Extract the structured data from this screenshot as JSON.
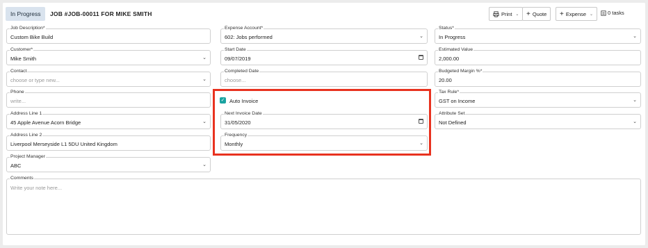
{
  "header": {
    "status_badge": "In Progress",
    "job_title": "JOB #JOB-00011 FOR MIKE SMITH",
    "print_label": "Print",
    "quote_label": "Quote",
    "expense_label": "Expense",
    "tasks_label": "0 tasks"
  },
  "fields": {
    "job_description": {
      "label": "Job Description*",
      "value": "Custom Bike Build"
    },
    "customer": {
      "label": "Customer*",
      "value": "Mike Smith"
    },
    "contact": {
      "label": "Contact",
      "placeholder": "choose or type new..."
    },
    "phone": {
      "label": "Phone",
      "placeholder": "write..."
    },
    "address1": {
      "label": "Address Line 1",
      "value": "45 Apple Avenue Acorn Bridge"
    },
    "address2": {
      "label": "Address Line 2",
      "value": "Liverpool Merseyside L1 5DU United Kingdom"
    },
    "project_manager": {
      "label": "Project Manager",
      "value": "ABC"
    },
    "expense_account": {
      "label": "Expense Account*",
      "value": "602: Jobs performed"
    },
    "start_date": {
      "label": "Start Date",
      "value": "09/07/2019"
    },
    "completed_date": {
      "label": "Completed Date",
      "placeholder": "choose..."
    },
    "auto_invoice": {
      "label": "Auto Invoice",
      "checked": true
    },
    "next_invoice_date": {
      "label": "Next Invoice Date",
      "value": "31/05/2020"
    },
    "frequency": {
      "label": "Frequency",
      "value": "Monthly"
    },
    "status": {
      "label": "Status*",
      "value": "In Progress"
    },
    "estimated_value": {
      "label": "Estimated Value",
      "value": "2,000.00"
    },
    "budgeted_margin": {
      "label": "Budgeted Margin %*",
      "value": "20.00"
    },
    "tax_rule": {
      "label": "Tax Rule*",
      "value": "GST on Income"
    },
    "attribute_set": {
      "label": "Attribute Set",
      "value": "Not Defined"
    },
    "comments": {
      "label": "Comments",
      "placeholder": "Write your note here..."
    }
  },
  "icons": {
    "caret": "chevron-down-icon",
    "calendar": "calendar-icon",
    "print": "printer-icon",
    "tasks": "tasks-icon"
  },
  "colors": {
    "highlight": "#e8321f",
    "checkbox": "#1aa3a1",
    "badge_bg": "#d9e3ee"
  }
}
